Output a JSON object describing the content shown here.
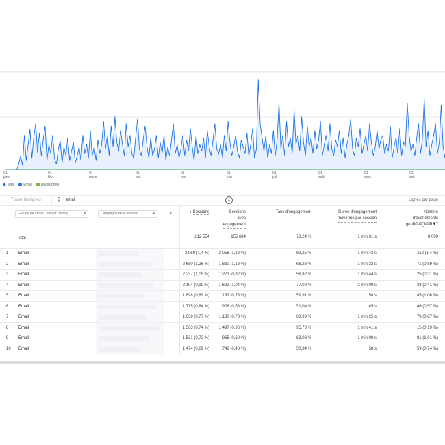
{
  "chart_data": {
    "type": "line",
    "x_labels": [
      {
        "day": "01",
        "month": "janv."
      },
      {
        "day": "01",
        "month": "févr."
      },
      {
        "day": "01",
        "month": "mars"
      },
      {
        "day": "01",
        "month": "avr."
      },
      {
        "day": "01",
        "month": "mai"
      },
      {
        "day": "01",
        "month": "juin"
      },
      {
        "day": "01",
        "month": "juil."
      },
      {
        "day": "01",
        "month": "août"
      },
      {
        "day": "01",
        "month": "sept."
      },
      {
        "day": "01",
        "month": "oct."
      }
    ],
    "series": [
      {
        "name": "Email",
        "color": "#1a73e8",
        "values": [
          0,
          0,
          0,
          0,
          0,
          0,
          0,
          5,
          12,
          4,
          30,
          8,
          22,
          35,
          10,
          28,
          40,
          15,
          32,
          12,
          26,
          38,
          8,
          22,
          14,
          30,
          10,
          5,
          18,
          25,
          6,
          20,
          12,
          28,
          8,
          16,
          24,
          6,
          12,
          20,
          8,
          30,
          14,
          22,
          10,
          34,
          12,
          20,
          8,
          26,
          14,
          22,
          42,
          18,
          30,
          12,
          38,
          20,
          46,
          24,
          16,
          34,
          22,
          12,
          40,
          20,
          30,
          14,
          10,
          28,
          44,
          18,
          12,
          26,
          38,
          20,
          10,
          28,
          12,
          18,
          30,
          10,
          24,
          14,
          30,
          8,
          20,
          12,
          26,
          40,
          14,
          22,
          10,
          18,
          30,
          12,
          26,
          16,
          36,
          20,
          8,
          30,
          14,
          22,
          16,
          28,
          10,
          34,
          20,
          12,
          26,
          40,
          18,
          14,
          22,
          10,
          30,
          16,
          42,
          24,
          12,
          20,
          30,
          16,
          10,
          26,
          20,
          14,
          32,
          12,
          22,
          36,
          10,
          18,
          78,
          40,
          28,
          16,
          30,
          10,
          22,
          14,
          34,
          12,
          26,
          58,
          18,
          30,
          12,
          42,
          20,
          28,
          14,
          52,
          22,
          30,
          16,
          46,
          24,
          12,
          38,
          20,
          28,
          14,
          34,
          18,
          26,
          42,
          12,
          22,
          30,
          16,
          40,
          18,
          12,
          26,
          20,
          34,
          14,
          28,
          10,
          22,
          30,
          44,
          18,
          12,
          28,
          20,
          36,
          14,
          22,
          30,
          16,
          40,
          24,
          12,
          20,
          34,
          18,
          26,
          30,
          14,
          22,
          16,
          38,
          10,
          20,
          28,
          14,
          36,
          12,
          24,
          20,
          58,
          30,
          16,
          22,
          12,
          28,
          40,
          14,
          26,
          62,
          20,
          34,
          12,
          22,
          30,
          40,
          14,
          24,
          56,
          20,
          10
        ]
      },
      {
        "name": "Unassigned",
        "color": "#34a853",
        "values": [
          0,
          0,
          0,
          0,
          0,
          0,
          0,
          0,
          0,
          0
        ]
      }
    ],
    "legend": [
      "Total",
      "Email",
      "Unassigned"
    ],
    "grid": true
  },
  "legend": {
    "total": "Total",
    "email": "Email",
    "unassigned": "Unassigned"
  },
  "toolbar": {
    "plot_rows": "Tracer les lignes",
    "search_value": "email",
    "rows_per_page": "Lignes par page :"
  },
  "filters": {
    "dim1": "Groupe de canau...ux par défaut)",
    "dim2": "Campagne de la session"
  },
  "columns": {
    "sessions": "Sessions",
    "engaged_l1": "Sessions",
    "engaged_l2": "avec",
    "engaged_l3": "engagement",
    "engagement_rate": "Taux d'engagement",
    "avg_l1": "Durée d'engagement",
    "avg_l2": "moyenne par session",
    "events_l1": "Nombre",
    "events_l2": "d'événements",
    "event_filter": "generate_lead"
  },
  "totals": {
    "label": "Total",
    "sessions": "212 554",
    "engaged": "155 684",
    "rate": "73,24 %",
    "duration": "1 min 31 s",
    "events": "8 009"
  },
  "rows": [
    {
      "n": "1",
      "channel": "Email",
      "sessions": "2 969 (1,4 %)",
      "engaged": "2 056 (1,32 %)",
      "rate": "69,25 %",
      "duration": "1 min 43 s",
      "events": "112 (1,4 %)"
    },
    {
      "n": "2",
      "channel": "Email",
      "sessions": "2 680 (1,26 %)",
      "engaged": "1 830 (1,18 %)",
      "rate": "68,28 %",
      "duration": "1 min 32 s",
      "events": "71 (0,89 %)"
    },
    {
      "n": "3",
      "channel": "Email",
      "sessions": "2 237 (1,05 %)",
      "engaged": "1 271 (0,82 %)",
      "rate": "56,82 %",
      "duration": "1 min 44 s",
      "events": "25 (0,31 %)"
    },
    {
      "n": "4",
      "channel": "Email",
      "sessions": "2 104 (0,99 %)",
      "engaged": "1 622 (1,04 %)",
      "rate": "77,09 %",
      "duration": "2 min 09 s",
      "events": "33 (0,41 %)"
    },
    {
      "n": "5",
      "channel": "Email",
      "sessions": "1 898 (0,89 %)",
      "engaged": "1 137 (0,73 %)",
      "rate": "59,91 %",
      "duration": "58 s",
      "events": "85 (1,06 %)"
    },
    {
      "n": "6",
      "channel": "Email",
      "sessions": "1 775 (0,84 %)",
      "engaged": "906 (0,58 %)",
      "rate": "51,04 %",
      "duration": "45 s",
      "events": "46 (0,57 %)"
    },
    {
      "n": "7",
      "channel": "Email",
      "sessions": "1 638 (0,77 %)",
      "engaged": "1 130 (0,73 %)",
      "rate": "68,99 %",
      "duration": "1 min 25 s",
      "events": "70 (0,87 %)"
    },
    {
      "n": "8",
      "channel": "Email",
      "sessions": "1 563 (0,74 %)",
      "engaged": "1 497 (0,96 %)",
      "rate": "95,78 %",
      "duration": "1 min 41 s",
      "events": "15 (0,19 %)"
    },
    {
      "n": "9",
      "channel": "Email",
      "sessions": "1 531 (0,72 %)",
      "engaged": "965 (0,62 %)",
      "rate": "63,03 %",
      "duration": "1 min 09 s",
      "events": "81 (1,01 %)"
    },
    {
      "n": "10",
      "channel": "Email",
      "sessions": "1 474 (0,69 %)",
      "engaged": "742 (0,48 %)",
      "rate": "50,34 %",
      "duration": "58 s",
      "events": "59 (0,74 %)"
    }
  ]
}
